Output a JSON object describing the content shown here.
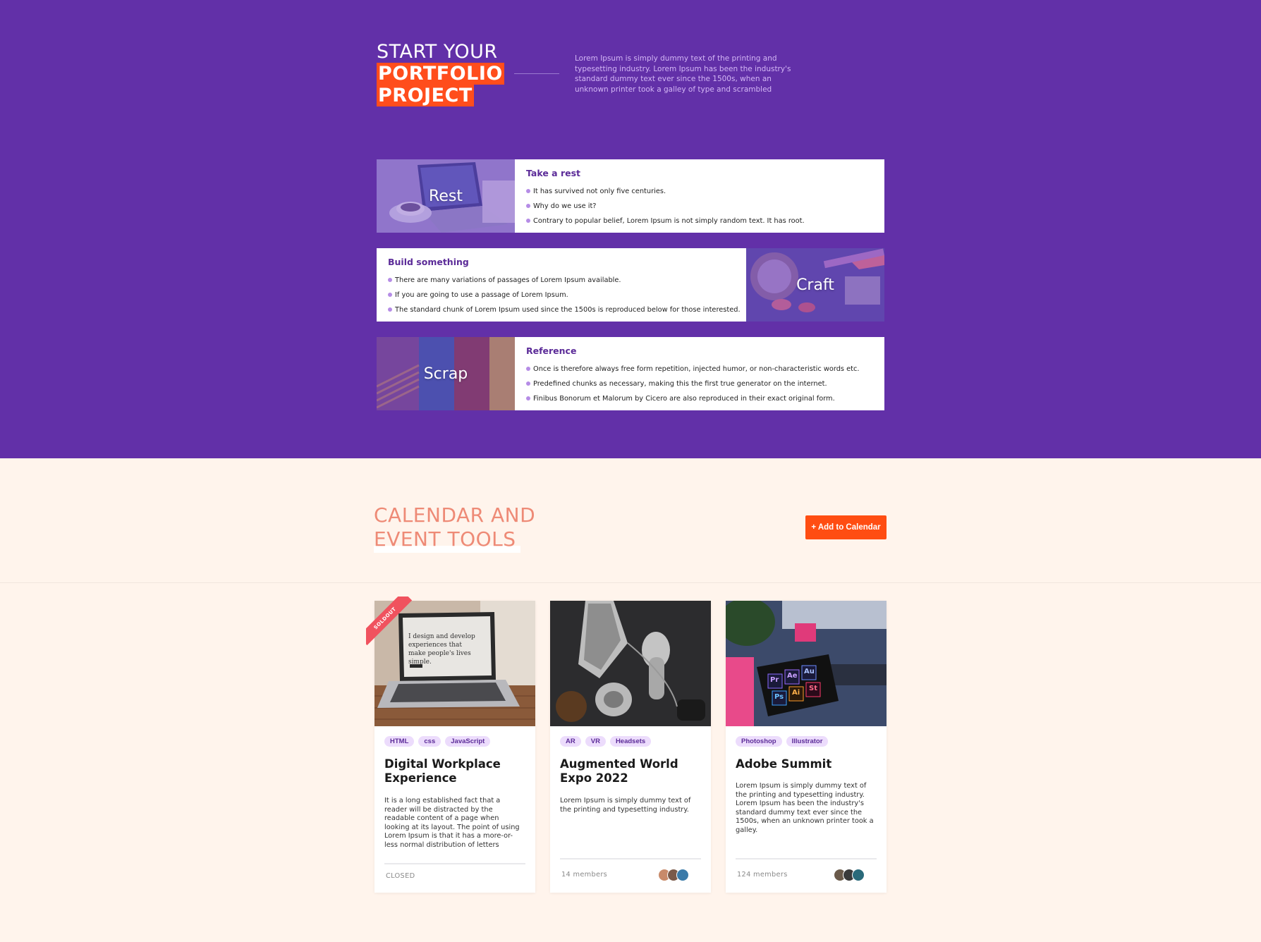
{
  "colors": {
    "hero_bg": "#6230a8",
    "accent": "#ff4d1c",
    "section_bg": "#fff4ec",
    "calendar_title": "#ee8a76",
    "tag_bg": "#ecdcfc",
    "tag_text": "#5b2b98",
    "bullet": "#b58ce6"
  },
  "hero": {
    "title_line1": "START YOUR",
    "title_line2": "PORTFOLIO",
    "title_line3": "PROJECT",
    "description": "Lorem Ipsum is simply dummy text of the printing and typesetting industry. Lorem Ipsum has been the industry's standard dummy text ever since the 1500s, when an unknown printer took a galley of type and scrambled"
  },
  "features": [
    {
      "image_caption": "Rest",
      "title": "Take a rest",
      "items": [
        "It has survived not only five centuries.",
        "Why do we use it?",
        "Contrary to popular belief, Lorem Ipsum is not simply random text. It has root."
      ]
    },
    {
      "image_caption": "Craft",
      "title": "Build something",
      "items": [
        "There are many variations of passages of Lorem Ipsum available.",
        "If you are going to use a passage of Lorem Ipsum.",
        "The standard chunk of Lorem Ipsum used since the 1500s is reproduced below for those interested."
      ]
    },
    {
      "image_caption": "Scrap",
      "title": "Reference",
      "items": [
        "Once is therefore always free form repetition, injected humor, or non-characteristic words etc.",
        "Predefined chunks as necessary, making this the first true generator on the internet.",
        "Finibus Bonorum et Malorum by Cicero are also reproduced in their exact original form."
      ]
    }
  ],
  "calendar": {
    "title_line1": "CALENDAR AND",
    "title_line2": "EVENT TOOLS",
    "button_label": "+ Add to Calendar"
  },
  "events": [
    {
      "ribbon": "SOLDOUT",
      "image_text": "I design and develop experiences that make people's lives simple.",
      "tags": [
        "HTML",
        "css",
        "JavaScript"
      ],
      "title": "Digital Workplace Experience",
      "description": "It is a long established fact that a reader will be distracted by the readable content of a page when looking at its layout. The point of using Lorem Ipsum is that it has a more-or-less normal distribution of letters",
      "status": "CLOSED"
    },
    {
      "tags": [
        "AR",
        "VR",
        "Headsets"
      ],
      "title": "Augmented World Expo 2022",
      "description": "Lorem Ipsum is simply dummy text of the printing and typesetting industry.",
      "status": "14 members"
    },
    {
      "image_text": [
        "Pr",
        "Ae",
        "Au",
        "Ps",
        "Ai",
        "St"
      ],
      "tags": [
        "Photoshop",
        "Illustrator"
      ],
      "title": "Adobe Summit",
      "description": "Lorem Ipsum is simply dummy text of the printing and typesetting industry. Lorem Ipsum has been the industry's standard dummy text ever since the 1500s, when an unknown printer took a galley.",
      "status": "124 members"
    }
  ]
}
